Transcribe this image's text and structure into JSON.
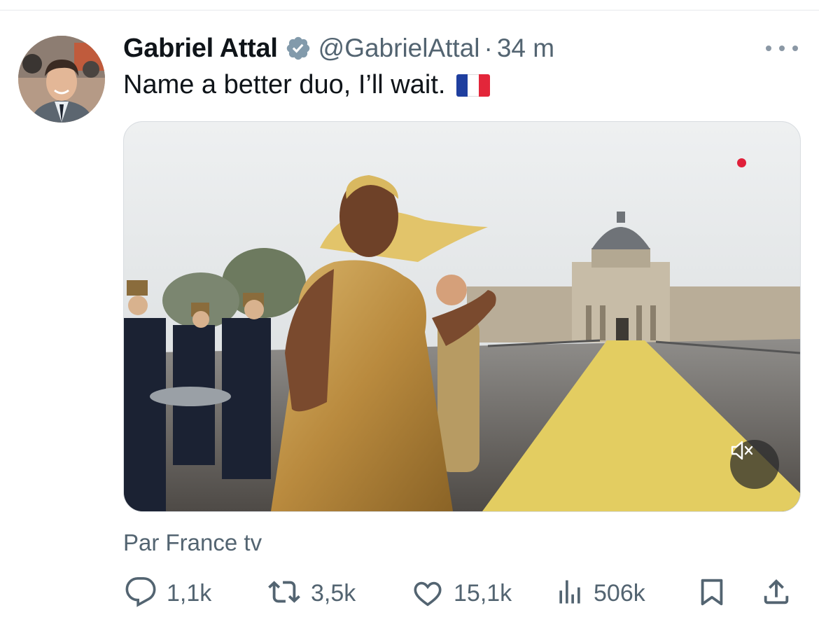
{
  "tweet": {
    "author_name": "Gabriel Attal",
    "handle": "@GabrielAttal",
    "separator": "·",
    "time": "34 m",
    "text": "Name a better duo, I’ll wait.",
    "flag_emoji": "france-flag",
    "source": "Par France tv"
  },
  "media": {
    "type": "video",
    "muted": true,
    "recording_indicator_color": "#e0203a"
  },
  "actions": {
    "replies": "1,1k",
    "reposts": "3,5k",
    "likes": "15,1k",
    "views": "506k"
  },
  "icons": {
    "verified": "verified-badge-icon",
    "more": "more-options-icon",
    "reply": "reply-icon",
    "repost": "repost-icon",
    "like": "like-icon",
    "views": "views-icon",
    "bookmark": "bookmark-icon",
    "share": "share-icon",
    "mute": "volume-muted-icon"
  },
  "colors": {
    "text_primary": "#0f1419",
    "text_secondary": "#536471",
    "verified_badge": "#829aab"
  }
}
